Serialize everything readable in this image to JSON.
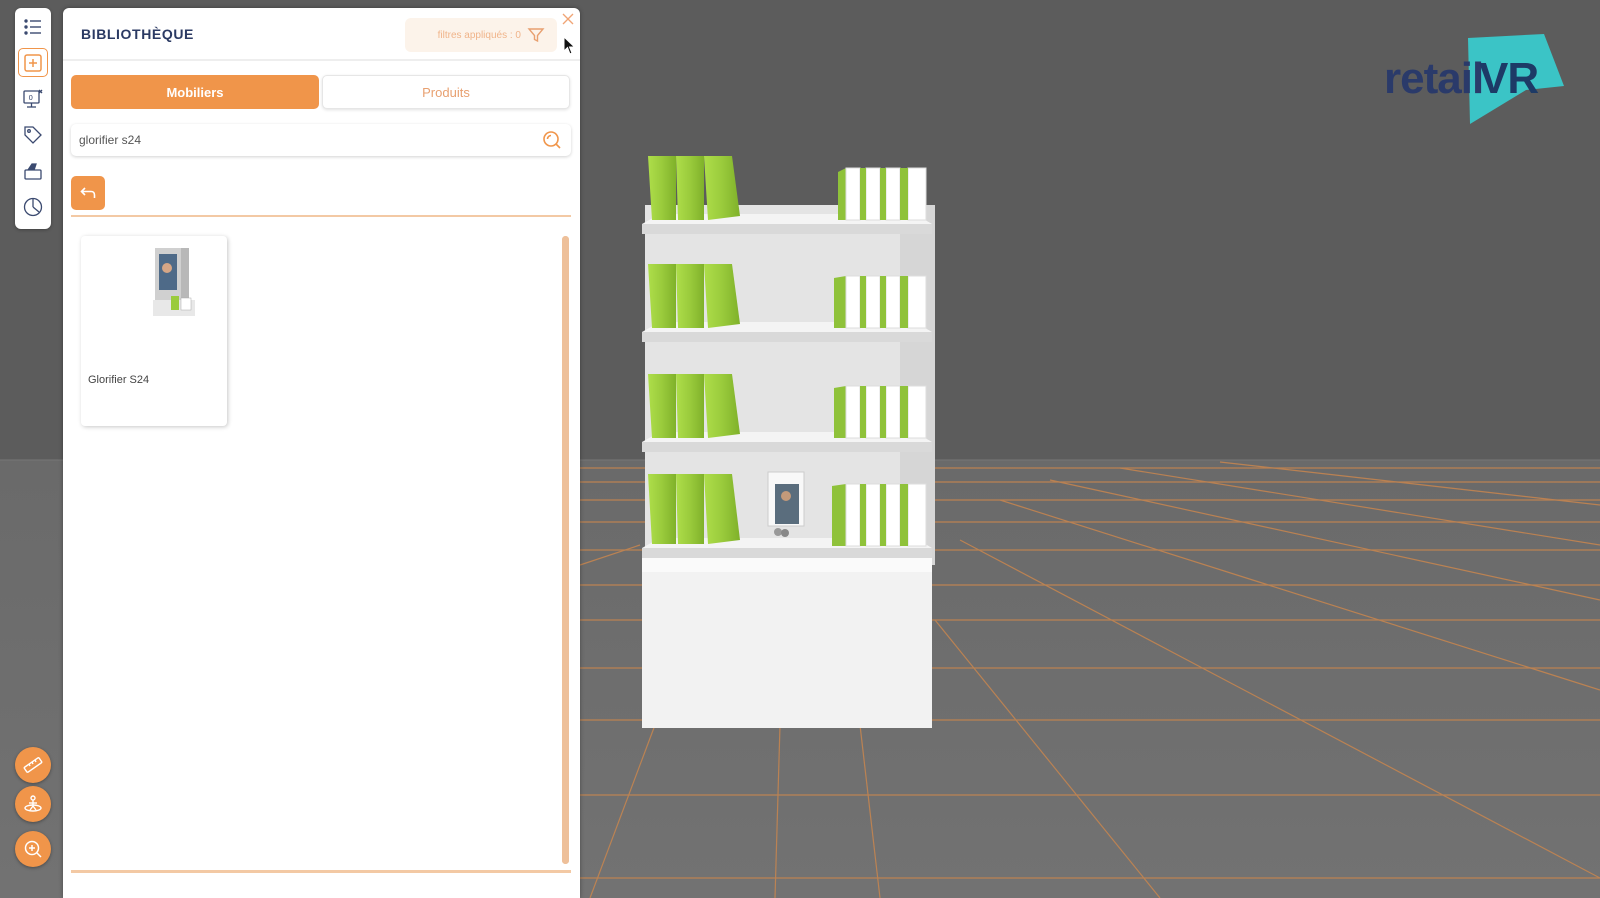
{
  "library": {
    "title": "BIBLIOTHÈQUE",
    "filter_label": "filtres appliqués : 0",
    "tabs": [
      {
        "label": "Mobiliers",
        "active": true
      },
      {
        "label": "Produits",
        "active": false
      }
    ],
    "search": {
      "value": "glorifier s24",
      "placeholder": ""
    },
    "results": [
      {
        "name": "Glorifier S24",
        "icon": "gondola-thumbnail"
      }
    ]
  },
  "toolbar": {
    "items": [
      {
        "icon": "list-icon",
        "active": false
      },
      {
        "icon": "add-square-icon",
        "active": true
      },
      {
        "icon": "monitor-counter-icon",
        "active": false
      },
      {
        "icon": "tag-icon",
        "active": false
      },
      {
        "icon": "paint-bucket-icon",
        "active": false
      },
      {
        "icon": "clock-icon",
        "active": false
      }
    ],
    "bottom_buttons": [
      {
        "icon": "ruler-icon"
      },
      {
        "icon": "person-rotate-icon"
      },
      {
        "icon": "zoom-in-icon"
      }
    ]
  },
  "logo": {
    "text_retail": "retail",
    "text_vr": "VR",
    "accent_color": "#3bc4c6"
  },
  "colors": {
    "accent": "#f0954a",
    "title": "#2b3a63",
    "product_green": "#9acb3c",
    "floor_grid": "#d98a4a"
  }
}
